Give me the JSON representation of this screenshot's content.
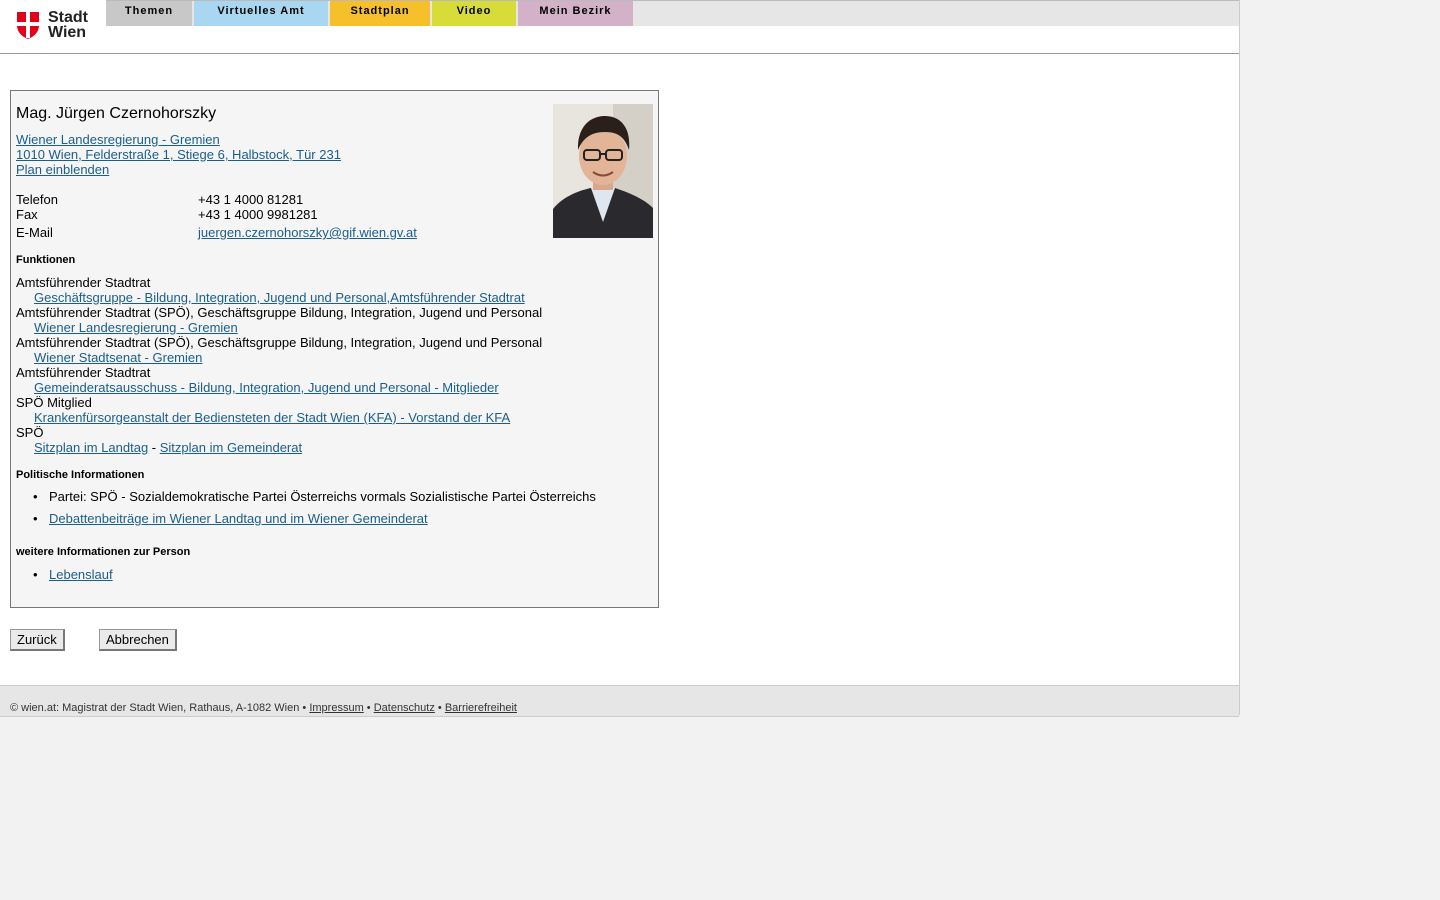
{
  "header": {
    "logo": {
      "line1": "Stadt",
      "line2": "Wien"
    },
    "nav": [
      {
        "label": "Themen",
        "color": "#c8c8c8"
      },
      {
        "label": "Virtuelles Amt",
        "color": "#a9d6f0"
      },
      {
        "label": "Stadtplan",
        "color": "#f5c02a"
      },
      {
        "label": "Video",
        "color": "#d7dc38"
      },
      {
        "label": "Mein Bezirk",
        "color": "#d3b2c9"
      }
    ]
  },
  "person": {
    "name": "Mag. Jürgen Czernohorszky",
    "org_link": "Wiener Landesregierung - Gremien ",
    "address_link": "1010 Wien, Felderstraße 1, Stiege 6, Halbstock, Tür 231",
    "map_link": "Plan einblenden",
    "contact": [
      {
        "label": "Telefon",
        "value": "+43 1 4000 81281"
      },
      {
        "label": "Fax",
        "value": "+43 1 4000 9981281"
      },
      {
        "label": "E-Mail",
        "value": "juergen.czernohorszky@gif.wien.gv.at"
      }
    ]
  },
  "funktionen": {
    "title": "Funktionen",
    "items": [
      {
        "role": "Amtsführender Stadtrat",
        "link": "Geschäftsgruppe - Bildung, Integration, Jugend und Personal,Amtsführender Stadtrat"
      },
      {
        "role": "Amtsführender Stadtrat (SPÖ), Geschäftsgruppe Bildung, Integration, Jugend und Personal",
        "link": "Wiener Landesregierung - Gremien"
      },
      {
        "role": "Amtsführender Stadtrat (SPÖ), Geschäftsgruppe Bildung, Integration, Jugend und Personal",
        "link": "Wiener Stadtsenat - Gremien"
      },
      {
        "role": "Amtsführender Stadtrat",
        "link": "Gemeinderatsausschuss - Bildung, Integration, Jugend und Personal - Mitglieder"
      },
      {
        "role": "SPÖ Mitglied",
        "link": "Krankenfürsorgeanstalt der Bediensteten der Stadt Wien (KFA) - Vorstand der KFA"
      }
    ],
    "last_role": "SPÖ",
    "sitzplan_landtag": "Sitzplan im Landtag",
    "separator": " - ",
    "sitzplan_gemeinderat": "Sitzplan im Gemeinderat"
  },
  "politisch": {
    "title": "Politische Informationen",
    "partei": "Partei: SPÖ - Sozialdemokratische Partei Österreichs vormals Sozialistische Partei Österreichs",
    "debatten_link": "Debattenbeiträge im Wiener Landtag und im Wiener Gemeinderat"
  },
  "weitere": {
    "title": "weitere Informationen zur Person",
    "lebenslauf_link": "Lebenslauf"
  },
  "buttons": {
    "back": "Zurück",
    "cancel": "Abbrechen"
  },
  "footer": {
    "copyright": "© wien.at: Magistrat der Stadt Wien, Rathaus, A-1082 Wien",
    "sep": " • ",
    "impressum": "Impressum",
    "datenschutz": "Datenschutz",
    "barriere": "Barrierefreiheit"
  }
}
